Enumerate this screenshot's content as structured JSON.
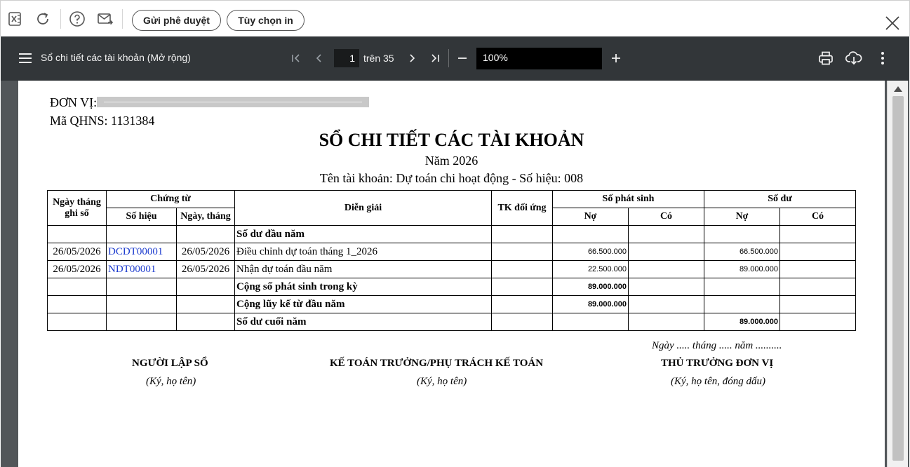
{
  "toolbar": {
    "icons": [
      "excel-icon",
      "refresh-icon",
      "help-icon",
      "send-mail-icon"
    ],
    "send_approval_label": "Gửi phê duyệt",
    "print_options_label": "Tùy chọn in"
  },
  "pdf_viewer": {
    "doc_title": "Sổ chi tiết các tài khoản (Mở rộng)",
    "current_page": "1",
    "page_of": "trên 35",
    "zoom": "100%"
  },
  "report": {
    "unit_label": "ĐƠN VỊ:",
    "qhns": "Mã QHNS: 1131384",
    "title": "SỔ CHI TIẾT CÁC TÀI KHOẢN",
    "year": "Năm 2026",
    "account": "Tên tài khoản: Dự toán chi hoạt động - Số hiệu: 008",
    "headers": {
      "date": "Ngày tháng ghi sổ",
      "voucher": "Chứng từ",
      "voucher_no": "Số hiệu",
      "voucher_date": "Ngày, tháng",
      "description": "Diễn giải",
      "contra": "TK đối ứng",
      "arising": "Số phát sinh",
      "balance": "Số dư",
      "debit": "Nợ",
      "credit": "Có",
      "debit2": "Nợ",
      "credit2": "Có"
    },
    "rows": [
      {
        "date": "",
        "voucher_no": "",
        "voucher_date": "",
        "description": "Số dư đầu năm",
        "contra": "",
        "arising_debit": "",
        "arising_credit": "",
        "balance_debit": "",
        "balance_credit": ""
      },
      {
        "date": "26/05/2026",
        "voucher_no": "DCDT00001",
        "voucher_date": "26/05/2026",
        "description": "Điều chỉnh dự toán tháng 1_2026",
        "contra": "",
        "arising_debit": "66.500.000",
        "arising_credit": "",
        "balance_debit": "66.500.000",
        "balance_credit": ""
      },
      {
        "date": "26/05/2026",
        "voucher_no": "NDT00001",
        "voucher_date": "26/05/2026",
        "description": "Nhận dự toán đầu năm",
        "contra": "",
        "arising_debit": "22.500.000",
        "arising_credit": "",
        "balance_debit": "89.000.000",
        "balance_credit": ""
      },
      {
        "date": "",
        "voucher_no": "",
        "voucher_date": "",
        "description": "Cộng số phát sinh trong kỳ",
        "contra": "",
        "arising_debit": "89.000.000",
        "arising_credit": "",
        "balance_debit": "",
        "balance_credit": ""
      },
      {
        "date": "",
        "voucher_no": "",
        "voucher_date": "",
        "description": "Cộng lũy kế từ đầu năm",
        "contra": "",
        "arising_debit": "89.000.000",
        "arising_credit": "",
        "balance_debit": "",
        "balance_credit": ""
      },
      {
        "date": "",
        "voucher_no": "",
        "voucher_date": "",
        "description": "Số dư cuối năm",
        "contra": "",
        "arising_debit": "",
        "arising_credit": "",
        "balance_debit": "89.000.000",
        "balance_credit": ""
      }
    ],
    "signatures": {
      "date_line": "Ngày ..... tháng ..... năm ..........",
      "preparer": "NGƯỜI LẬP SỔ",
      "preparer_note": "(Ký, họ tên)",
      "chief_accountant": "KẾ TOÁN TRƯỞNG/PHỤ TRÁCH KẾ TOÁN",
      "chief_accountant_note": "(Ký, họ tên)",
      "head": "THỦ TRƯỞNG ĐƠN VỊ",
      "head_note": "(Ký, họ tên, đóng dấu)"
    }
  }
}
